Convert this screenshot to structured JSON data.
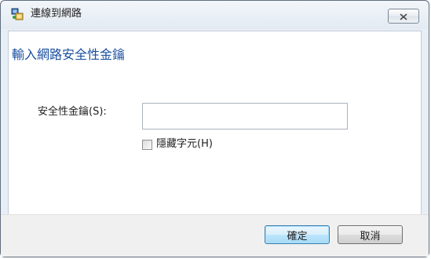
{
  "window": {
    "title": "連線到網路",
    "close_icon": "close-icon"
  },
  "main": {
    "heading": "輸入網路安全性金鑰",
    "key_label": "安全性金鑰(S):",
    "key_value": "",
    "hide_chars_label": "隱藏字元(H)",
    "hide_chars_checked": false
  },
  "footer": {
    "ok_label": "確定",
    "cancel_label": "取消"
  },
  "icons": {
    "title": "network-icon",
    "checkbox": "checkbox-icon"
  }
}
